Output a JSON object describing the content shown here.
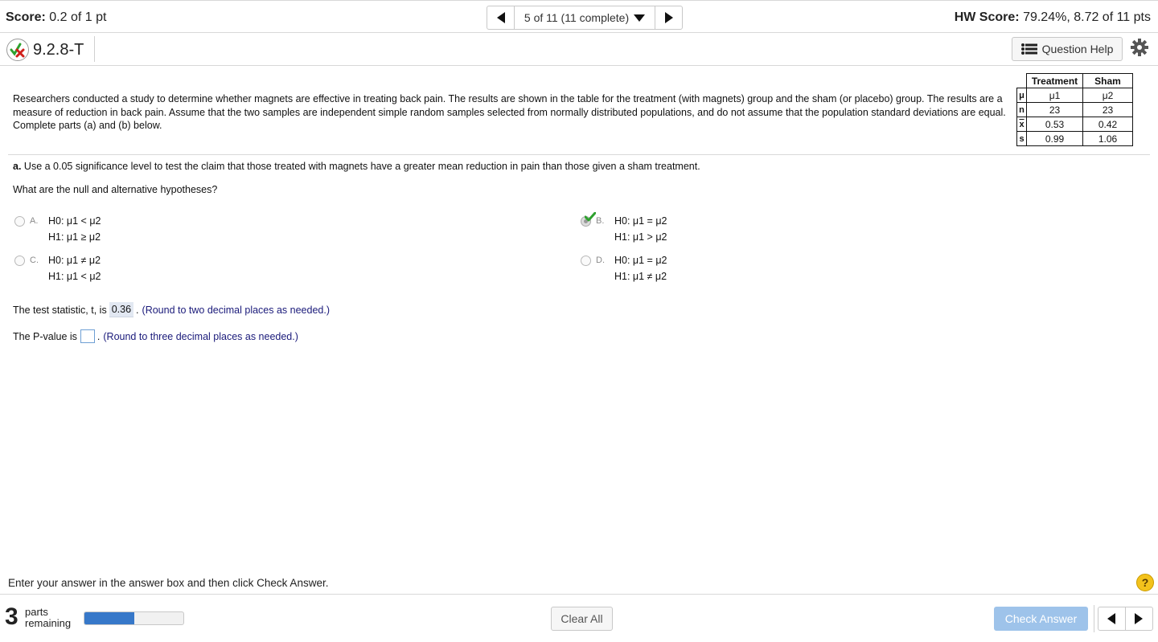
{
  "top": {
    "score_label": "Score:",
    "score_value": "0.2 of 1 pt",
    "nav_position": "5 of 11 (11 complete)",
    "hw_label": "HW Score:",
    "hw_value": "79.24%, 8.72 of 11 pts"
  },
  "question": {
    "id": "9.2.8-T",
    "help_label": "Question Help",
    "intro": "Researchers conducted a study to determine whether magnets are effective in treating back pain. The results are shown in the table for the treatment (with magnets) group and the sham (or placebo) group. The results are a measure of reduction in back pain. Assume that the two samples are independent simple random samples selected from normally distributed populations, and do not assume that the population standard deviations are equal. Complete parts (a) and (b) below."
  },
  "table": {
    "headers": [
      "Treatment",
      "Sham"
    ],
    "rows": [
      {
        "label": "μ",
        "treatment": "μ1",
        "sham": "μ2"
      },
      {
        "label": "n",
        "treatment": "23",
        "sham": "23"
      },
      {
        "label": "x",
        "treatment": "0.53",
        "sham": "0.42"
      },
      {
        "label": "s",
        "treatment": "0.99",
        "sham": "1.06"
      }
    ]
  },
  "part_a": {
    "label": "a.",
    "text": "Use a 0.05 significance level to test the claim that those treated with magnets have a greater mean reduction in pain than those given a sham treatment.",
    "hyp_question": "What are the null and alternative hypotheses?",
    "options": [
      {
        "letter": "A.",
        "h0": "H0: μ1 < μ2",
        "h1": "H1: μ1 ≥ μ2",
        "selected": false
      },
      {
        "letter": "B.",
        "h0": "H0: μ1 = μ2",
        "h1": "H1: μ1 > μ2",
        "selected": true
      },
      {
        "letter": "C.",
        "h0": "H0: μ1 ≠ μ2",
        "h1": "H1: μ1 < μ2",
        "selected": false
      },
      {
        "letter": "D.",
        "h0": "H0: μ1 = μ2",
        "h1": "H1: μ1 ≠ μ2",
        "selected": false
      }
    ],
    "stat_prefix": "The test statistic, t, is",
    "stat_value": "0.36",
    "stat_suffix": ".",
    "stat_hint": "(Round to two decimal places as needed.)",
    "pval_prefix": "The P-value is",
    "pval_value": "",
    "pval_suffix": ".",
    "pval_hint": "(Round to three decimal places as needed.)"
  },
  "footer": {
    "instruction": "Enter your answer in the answer box and then click Check Answer.",
    "help_symbol": "?",
    "parts_count": "3",
    "parts_label_1": "parts",
    "parts_label_2": "remaining",
    "progress_fraction": 0.5,
    "clear_label": "Clear All",
    "check_label": "Check Answer"
  },
  "colors": {
    "check_green": "#2ea12e",
    "status_red": "#d0211c",
    "progress_blue": "#3778c9",
    "check_button": "#9ec3ea",
    "hint_text": "#1a1a7a"
  },
  "icons": [
    "partial-credit-icon",
    "list-icon",
    "gear-icon",
    "arrow-left-icon",
    "arrow-right-icon",
    "dropdown-arrow-icon",
    "checkmark-icon",
    "question-help-icon"
  ]
}
